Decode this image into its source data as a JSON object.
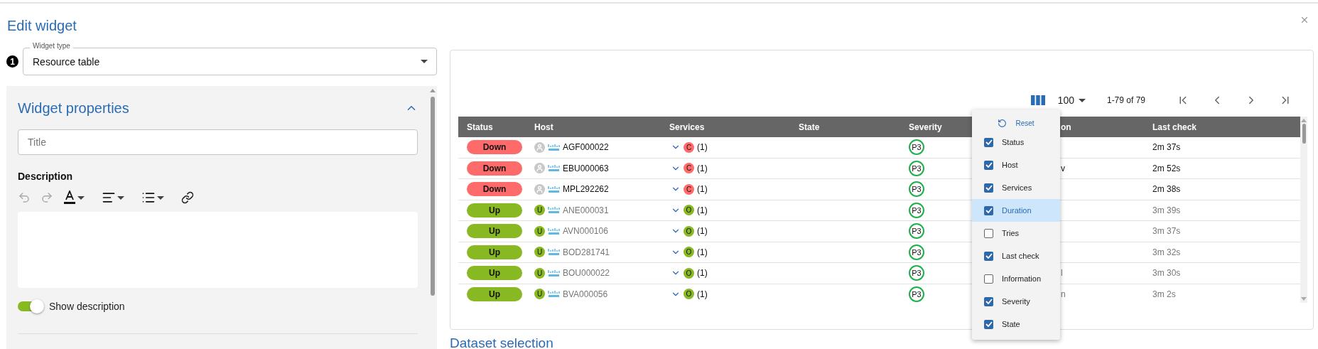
{
  "dialog": {
    "title": "Edit widget"
  },
  "widget_type": {
    "step": "1",
    "label": "Widget type",
    "value": "Resource table"
  },
  "properties": {
    "title": "Widget properties",
    "expanded": true,
    "title_field": {
      "placeholder": "Title"
    },
    "description_label": "Description",
    "show_description": {
      "label": "Show description",
      "on": true
    }
  },
  "preview": {
    "per_page": "100",
    "range": "1-79 of 79",
    "columns": [
      "Status",
      "Host",
      "Services",
      "State",
      "Severity",
      "on",
      "Last check"
    ],
    "rows": [
      {
        "kind": "down",
        "status_label": "Down",
        "host": "AGF000022",
        "service_letter": "C",
        "service_count": "(1)",
        "severity": "P3",
        "last_check": "2m 37s"
      },
      {
        "kind": "down",
        "status_label": "Down",
        "host": "EBU000063",
        "service_letter": "C",
        "service_count": "(1)",
        "severity": "P3",
        "duration": "v",
        "last_check": "2m 52s"
      },
      {
        "kind": "down",
        "status_label": "Down",
        "host": "MPL292262",
        "service_letter": "C",
        "service_count": "(1)",
        "severity": "P3",
        "last_check": "2m 38s"
      },
      {
        "kind": "up",
        "status_label": "Up",
        "host_letter": "U",
        "host": "ANE000031",
        "service_letter": "O",
        "service_count": "(1)",
        "severity": "P3",
        "last_check": "3m 39s"
      },
      {
        "kind": "up",
        "status_label": "Up",
        "host_letter": "U",
        "host": "AVN000106",
        "service_letter": "O",
        "service_count": "(1)",
        "severity": "P3",
        "last_check": "3m 37s"
      },
      {
        "kind": "up",
        "status_label": "Up",
        "host_letter": "U",
        "host": "BOD281741",
        "service_letter": "O",
        "service_count": "(1)",
        "severity": "P3",
        "last_check": "3m 32s"
      },
      {
        "kind": "up",
        "status_label": "Up",
        "host_letter": "U",
        "host": "BOU000022",
        "service_letter": "O",
        "service_count": "(1)",
        "severity": "P3",
        "duration": "l",
        "last_check": "3m 30s"
      },
      {
        "kind": "up",
        "status_label": "Up",
        "host_letter": "U",
        "host": "BVA000056",
        "service_letter": "O",
        "service_count": "(1)",
        "severity": "P3",
        "duration": "n",
        "last_check": "3m 2s"
      }
    ],
    "column_menu": {
      "reset": "Reset",
      "items": [
        {
          "label": "Status",
          "checked": true,
          "highlighted": false
        },
        {
          "label": "Host",
          "checked": true,
          "highlighted": false
        },
        {
          "label": "Services",
          "checked": true,
          "highlighted": false
        },
        {
          "label": "Duration",
          "checked": true,
          "highlighted": true
        },
        {
          "label": "Tries",
          "checked": false,
          "highlighted": false
        },
        {
          "label": "Last check",
          "checked": true,
          "highlighted": false
        },
        {
          "label": "Information",
          "checked": false,
          "highlighted": false
        },
        {
          "label": "Severity",
          "checked": true,
          "highlighted": false
        },
        {
          "label": "State",
          "checked": true,
          "highlighted": false
        }
      ]
    }
  },
  "dataset_title": "Dataset selection"
}
